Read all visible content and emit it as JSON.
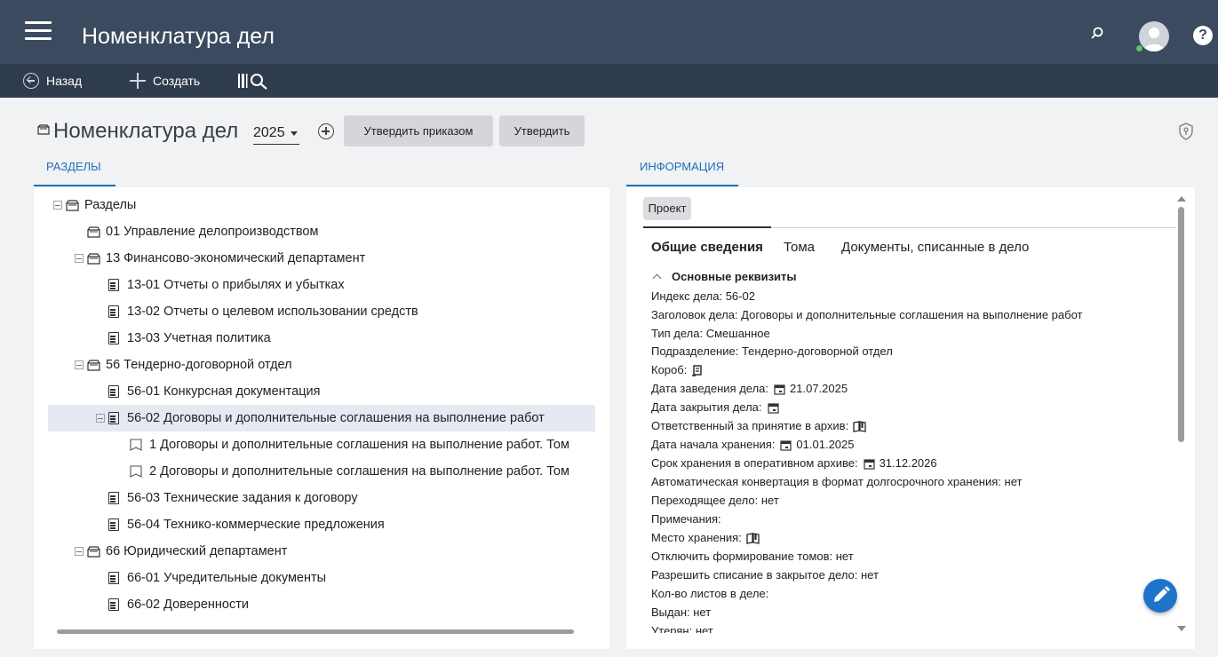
{
  "app": {
    "title": "Номенклатура дел"
  },
  "toolbar": {
    "back_label": "Назад",
    "create_label": "Создать"
  },
  "header": {
    "title": "Номенклатура дел",
    "year": "2025",
    "approve_by_order_label": "Утвердить приказом",
    "approve_label": "Утвердить"
  },
  "left_tab": "РАЗДЕЛЫ",
  "right_tab": "ИНФОРМАЦИЯ",
  "tree": {
    "root": "Разделы",
    "items": [
      "01 Управление делопроизводством",
      "13 Финансово-экономический департамент",
      "13-01 Отчеты о прибылях и убытках",
      "13-02 Отчеты о целевом использовании средств",
      "13-03 Учетная политика",
      "56 Тендерно-договорной отдел",
      "56-01 Конкурсная документация",
      "56-02 Договоры и дополнительные соглашения на выполнение работ",
      "1 Договоры и дополнительные соглашения на выполнение работ. Том",
      "2 Договоры и дополнительные соглашения на выполнение работ. Том",
      "56-03 Технические задания к договору",
      "56-04 Технико-коммерческие предложения",
      "66 Юридический департамент",
      "66-01 Учредительные документы",
      "66-02 Доверенности"
    ]
  },
  "info": {
    "status": "Проект",
    "subtabs": [
      "Общие сведения",
      "Тома",
      "Документы, списанные в дело"
    ],
    "section_title": "Основные реквизиты",
    "lines": [
      "Индекс дела: 56-02",
      "Заголовок дела: Договоры и дополнительные соглашения на выполнение работ",
      "Тип дела: Смешанное",
      "Подразделение: Тендерно-договорной отдел",
      "Короб:",
      "Дата заведения дела:",
      "Дата закрытия дела:",
      "Ответственный за принятие в архив:",
      "Дата начала хранения:",
      "Срок хранения в оперативном архиве:",
      "Автоматическая конвертация в формат долгосрочного хранения: нет",
      "Переходящее дело: нет",
      "Примечания:",
      "Место хранения:",
      "Отключить формирование томов: нет",
      "Разрешить списание в закрытое дело: нет",
      "Кол-во листов в деле:",
      "Выдан: нет",
      "Утерян: нет"
    ],
    "date_created": "21.07.2025",
    "storage_start": "01.01.2025",
    "operational_term": "31.12.2026"
  },
  "colors": {
    "topbar": "#3b4a5e",
    "toolbar": "#2f3c4d",
    "accent": "#1f6fb8",
    "fab": "#1e74c9"
  }
}
